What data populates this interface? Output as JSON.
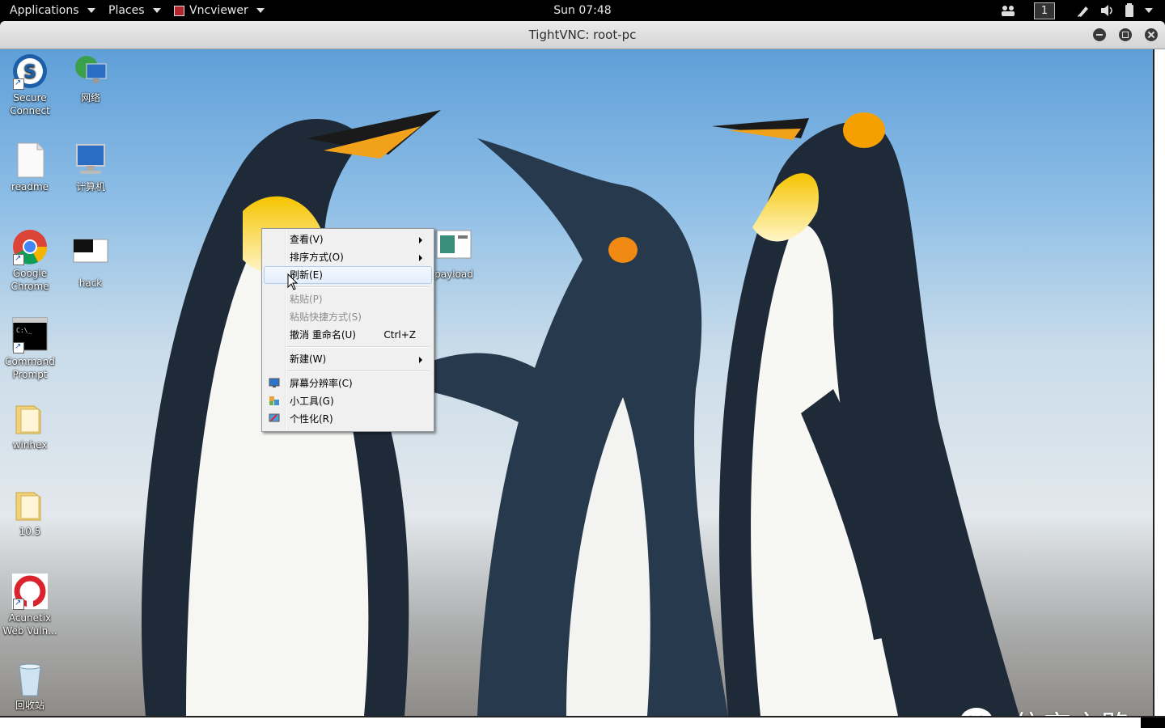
{
  "topbar": {
    "applications_label": "Applications",
    "places_label": "Places",
    "vncviewer_label": "Vncviewer",
    "clock": "Sun 07:48",
    "workspace_number": "1"
  },
  "window": {
    "title": "TightVNC: root-pc"
  },
  "desktop_icons": {
    "secure_connect": "Secure Connect",
    "network": "网络",
    "readme": "readme",
    "computer": "计算机",
    "google_chrome": "Google Chrome",
    "hack": "hack",
    "payload": "payload",
    "command_prompt": "Command Prompt",
    "winhex": "winhex",
    "folder_105": "10.5",
    "acunetix": "Acunetix Web Vuln...",
    "recycle_bin": "回收站"
  },
  "context_menu": {
    "view": "查看(V)",
    "sort_by": "排序方式(O)",
    "refresh": "刷新(E)",
    "paste": "粘贴(P)",
    "paste_shortcut": "粘贴快捷方式(S)",
    "undo_rename": "撤消 重命名(U)",
    "undo_shortcut": "Ctrl+Z",
    "new": "新建(W)",
    "screen_resolution": "屏幕分辨率(C)",
    "gadgets": "小工具(G)",
    "personalize": "个性化(R)"
  },
  "watermark": {
    "text": "信安之路"
  },
  "colors": {
    "topbar_bg": "#000000",
    "titlebar_bg": "#dcdcdc",
    "menu_bg": "#f0f0f0",
    "menu_highlight_border": "#aecff7",
    "disabled_text": "#8d8d8d"
  }
}
